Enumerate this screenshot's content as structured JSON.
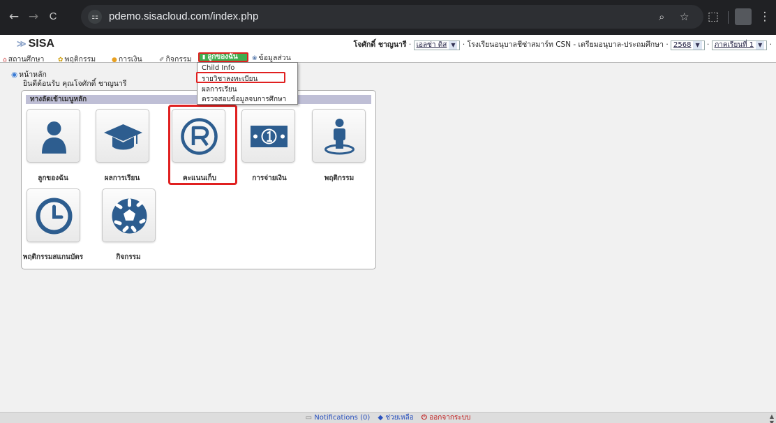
{
  "browser": {
    "url": "pdemo.sisacloud.com/index.php",
    "back_glyph": "←",
    "forward_glyph": "→",
    "reload_glyph": "C",
    "site_info_glyph": "⚏",
    "zoom_glyph": "⌕",
    "star_glyph": "☆",
    "extensions_glyph": "⬚",
    "menu_glyph": "⋮"
  },
  "header": {
    "logo_text": "SISA",
    "user_name": "โจศักดิ์ ชาญนารี",
    "child_select": "เอลซ่า ดิส",
    "school_text": "โรงเรียนอนุบาลชีซ่าสมาร์ท CSN - เตรียมอนุบาล-ประถมศึกษา",
    "year_select": "2568",
    "term_select": "ภาคเรียนที่ 1"
  },
  "menubar": {
    "items": [
      {
        "label": "สถานศึกษา",
        "icon": "home-icon"
      },
      {
        "label": "พฤติกรรม",
        "icon": "behavior-icon"
      },
      {
        "label": "การเงิน",
        "icon": "money-icon"
      },
      {
        "label": "กิจกรรม",
        "icon": "activity-icon"
      },
      {
        "label": "ลูกของฉัน",
        "icon": "child-icon"
      },
      {
        "label": "ข้อมูลส่วน",
        "icon": "profile-icon"
      }
    ]
  },
  "dropdown": {
    "items": [
      "Child Info",
      "รายวิชาลงทะเบียน",
      "ผลการเรียน",
      "ตรวจสอบข้อมูลจบการศึกษา"
    ]
  },
  "breadcrumb": {
    "home": "หน้าหลัก",
    "welcome": "ยินดีต้อนรับ คุณโจศักดิ์ ชาญนารี"
  },
  "panel": {
    "title": "ทางลัดเข้าเมนูหลัก",
    "tiles": [
      {
        "label": "ลูกของฉัน",
        "icon": "person-icon"
      },
      {
        "label": "ผลการเรียน",
        "icon": "graduation-cap-icon"
      },
      {
        "label": "คะแนนเก็บ",
        "icon": "registered-icon"
      },
      {
        "label": "การจ่ายเงิน",
        "icon": "banknote-icon"
      },
      {
        "label": "พฤติกรรม",
        "icon": "person-on-spot-icon"
      },
      {
        "label": "พฤติกรรมสแกนบัตร",
        "icon": "clock-icon"
      },
      {
        "label": "กิจกรรม",
        "icon": "soccer-ball-icon"
      }
    ]
  },
  "footer": {
    "notifications": "Notifications (0)",
    "help": "ช่วยเหลือ",
    "logout": "ออกจากระบบ"
  },
  "colors": {
    "highlight": "#e02020",
    "icon_blue": "#2d5d8f",
    "menu_active": "#3fae4f"
  }
}
